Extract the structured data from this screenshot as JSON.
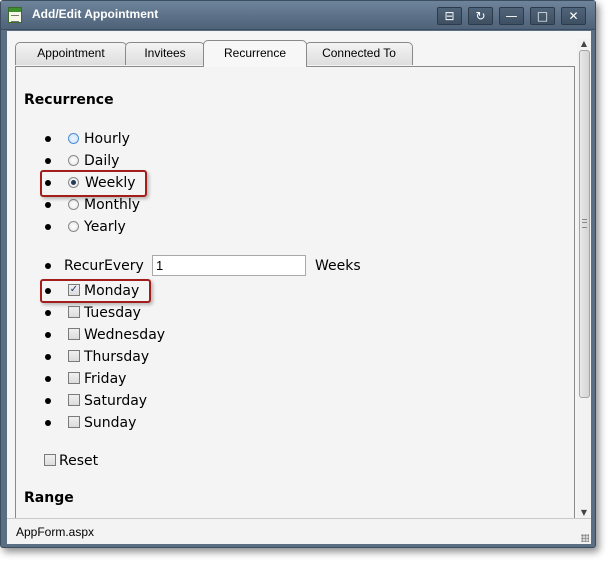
{
  "window": {
    "title": "Add/Edit Appointment",
    "titlebar_buttons": {
      "pin": "⊟",
      "refresh": "↻",
      "minimize": "—",
      "maximize": "□",
      "close": "✕"
    }
  },
  "tabs": [
    {
      "label": "Appointment",
      "active": false
    },
    {
      "label": "Invitees",
      "active": false
    },
    {
      "label": "Recurrence",
      "active": true
    },
    {
      "label": "Connected To",
      "active": false
    }
  ],
  "recurrence": {
    "heading": "Recurrence",
    "options": [
      {
        "label": "Hourly",
        "checked": false
      },
      {
        "label": "Daily",
        "checked": false
      },
      {
        "label": "Weekly",
        "checked": true
      },
      {
        "label": "Monthly",
        "checked": false
      },
      {
        "label": "Yearly",
        "checked": false
      }
    ],
    "recur_every_label": "RecurEvery",
    "recur_every_value": "1",
    "weeks_label": "Weeks",
    "days": [
      {
        "label": "Monday",
        "checked": true
      },
      {
        "label": "Tuesday",
        "checked": false
      },
      {
        "label": "Wednesday",
        "checked": false
      },
      {
        "label": "Thursday",
        "checked": false
      },
      {
        "label": "Friday",
        "checked": false
      },
      {
        "label": "Saturday",
        "checked": false
      },
      {
        "label": "Sunday",
        "checked": false
      }
    ],
    "reset_label": "Reset"
  },
  "range": {
    "heading": "Range"
  },
  "statusbar": {
    "text": "AppForm.aspx"
  },
  "colors": {
    "titlebar": "#5b6f84",
    "highlight": "#a31d1d",
    "checkmark": "#1f3a7a"
  }
}
